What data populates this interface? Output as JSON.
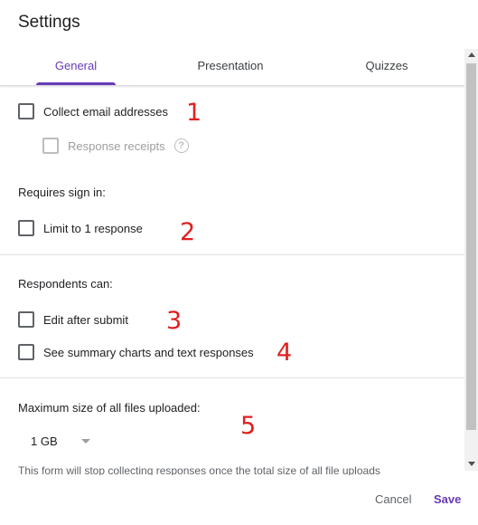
{
  "dialog": {
    "title": "Settings",
    "tabs": [
      {
        "label": "General",
        "active": true
      },
      {
        "label": "Presentation",
        "active": false
      },
      {
        "label": "Quizzes",
        "active": false
      }
    ]
  },
  "general": {
    "collect_email": {
      "label": "Collect email addresses",
      "checked": false
    },
    "response_receipts": {
      "label": "Response receipts",
      "checked": false,
      "disabled": true
    },
    "requires_sign_in": {
      "heading": "Requires sign in:",
      "limit_one": {
        "label": "Limit to 1 response",
        "checked": false
      }
    },
    "respondents_can": {
      "heading": "Respondents can:",
      "edit_after_submit": {
        "label": "Edit after submit",
        "checked": false
      },
      "see_summary": {
        "label": "See summary charts and text responses",
        "checked": false
      }
    },
    "max_upload": {
      "heading": "Maximum size of all files uploaded:",
      "selected": "1 GB",
      "hint": "This form will stop collecting responses once the total size of all file uploads"
    }
  },
  "annotations": [
    "1",
    "2",
    "3",
    "4",
    "5"
  ],
  "footer": {
    "cancel_label": "Cancel",
    "save_label": "Save"
  },
  "colors": {
    "accent": "#673ab7",
    "annotation": "#e02020",
    "divider": "#e0e0e0"
  },
  "icons": {
    "help": "question-circle-icon",
    "dropdown": "caret-down-icon"
  }
}
